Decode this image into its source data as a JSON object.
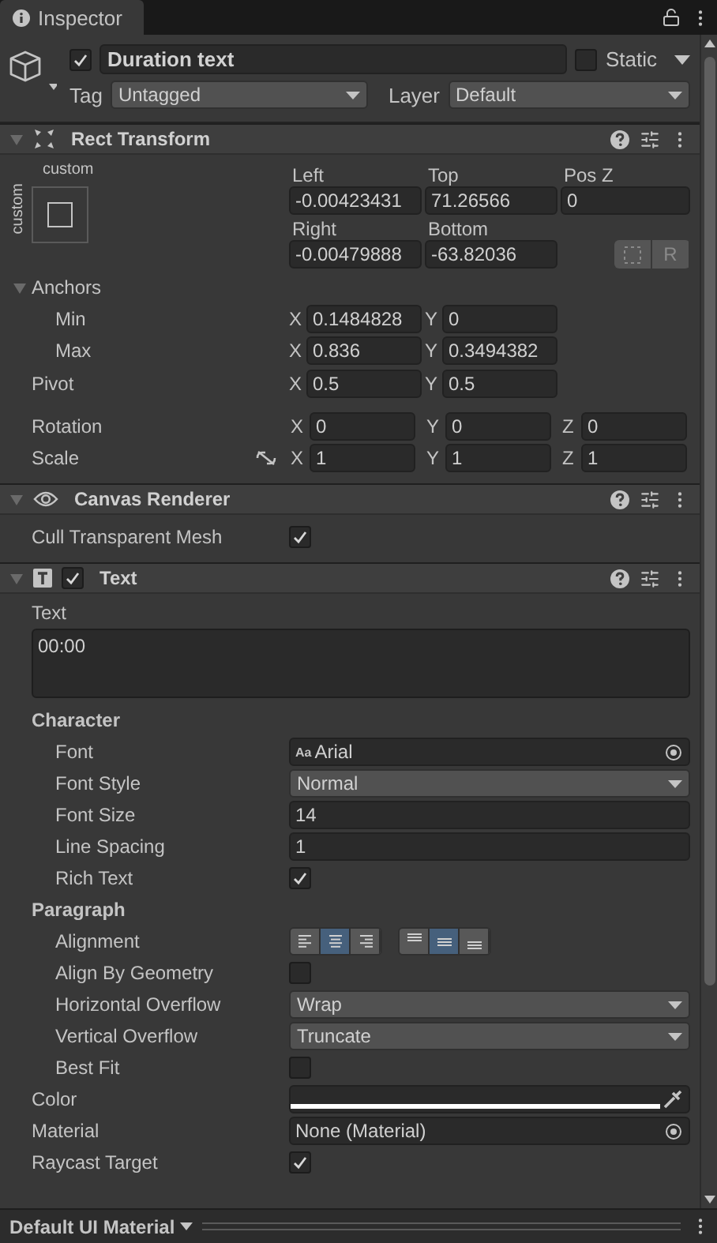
{
  "tab": {
    "title": "Inspector"
  },
  "header": {
    "active": true,
    "name": "Duration text",
    "static_label": "Static",
    "static": false,
    "tag_label": "Tag",
    "tag": "Untagged",
    "layer_label": "Layer",
    "layer": "Default"
  },
  "components": [
    {
      "kind": "rect_transform",
      "title": "Rect Transform",
      "expanded": true,
      "preset_label": "custom",
      "preset_side_label": "custom",
      "fields_1": [
        {
          "label": "Left",
          "value": "-0.00423431"
        },
        {
          "label": "Top",
          "value": "71.26566"
        },
        {
          "label": "Pos Z",
          "value": "0"
        }
      ],
      "fields_2": [
        {
          "label": "Right",
          "value": "-0.00479888"
        },
        {
          "label": "Bottom",
          "value": "-63.82036"
        }
      ],
      "r_button": "R",
      "anchors": {
        "label": "Anchors",
        "expanded": true,
        "rows": [
          {
            "label": "Min",
            "values": [
              {
                "axis": "X",
                "value": "0.1484828"
              },
              {
                "axis": "Y",
                "value": "0"
              }
            ]
          },
          {
            "label": "Max",
            "values": [
              {
                "axis": "X",
                "value": "0.836"
              },
              {
                "axis": "Y",
                "value": "0.3494382"
              }
            ]
          }
        ]
      },
      "pivot": {
        "label": "Pivot",
        "values": [
          {
            "axis": "X",
            "value": "0.5"
          },
          {
            "axis": "Y",
            "value": "0.5"
          }
        ]
      },
      "rotation": {
        "label": "Rotation",
        "values": [
          {
            "axis": "X",
            "value": "0"
          },
          {
            "axis": "Y",
            "value": "0"
          },
          {
            "axis": "Z",
            "value": "0"
          }
        ]
      },
      "scale": {
        "label": "Scale",
        "linked": false,
        "values": [
          {
            "axis": "X",
            "value": "1"
          },
          {
            "axis": "Y",
            "value": "1"
          },
          {
            "axis": "Z",
            "value": "1"
          }
        ]
      }
    },
    {
      "kind": "canvas_renderer",
      "title": "Canvas Renderer",
      "expanded": true,
      "properties": [
        {
          "kind": "checkbox",
          "label": "Cull Transparent Mesh",
          "checked": true
        }
      ]
    },
    {
      "kind": "text",
      "title": "Text",
      "expanded": true,
      "enabled": true,
      "properties": [
        {
          "kind": "textarea",
          "label": "Text",
          "value": "00:00"
        },
        {
          "kind": "heading",
          "label": "Character",
          "children": [
            {
              "kind": "object",
              "label": "Font",
              "badge": "Aa",
              "value": "Arial"
            },
            {
              "kind": "dropdown",
              "label": "Font Style",
              "value": "Normal"
            },
            {
              "kind": "number",
              "label": "Font Size",
              "value": "14"
            },
            {
              "kind": "number",
              "label": "Line Spacing",
              "value": "1"
            },
            {
              "kind": "checkbox",
              "label": "Rich Text",
              "checked": true
            }
          ]
        },
        {
          "kind": "heading",
          "label": "Paragraph",
          "children": [
            {
              "kind": "alignment",
              "label": "Alignment",
              "horizontal": [
                {
                  "selected": false
                },
                {
                  "selected": true
                },
                {
                  "selected": false
                }
              ],
              "vertical": [
                {
                  "selected": false
                },
                {
                  "selected": true
                },
                {
                  "selected": false
                }
              ]
            },
            {
              "kind": "checkbox",
              "label": "Align By Geometry",
              "checked": false
            },
            {
              "kind": "dropdown",
              "label": "Horizontal Overflow",
              "value": "Wrap"
            },
            {
              "kind": "dropdown",
              "label": "Vertical Overflow",
              "value": "Truncate"
            },
            {
              "kind": "checkbox",
              "label": "Best Fit",
              "checked": false
            }
          ]
        },
        {
          "kind": "color",
          "label": "Color",
          "color": "#ffffff"
        },
        {
          "kind": "object",
          "label": "Material",
          "value": "None (Material)"
        },
        {
          "kind": "checkbox",
          "label": "Raycast Target",
          "checked": true
        }
      ]
    }
  ],
  "footer": {
    "material": "Default UI Material"
  }
}
